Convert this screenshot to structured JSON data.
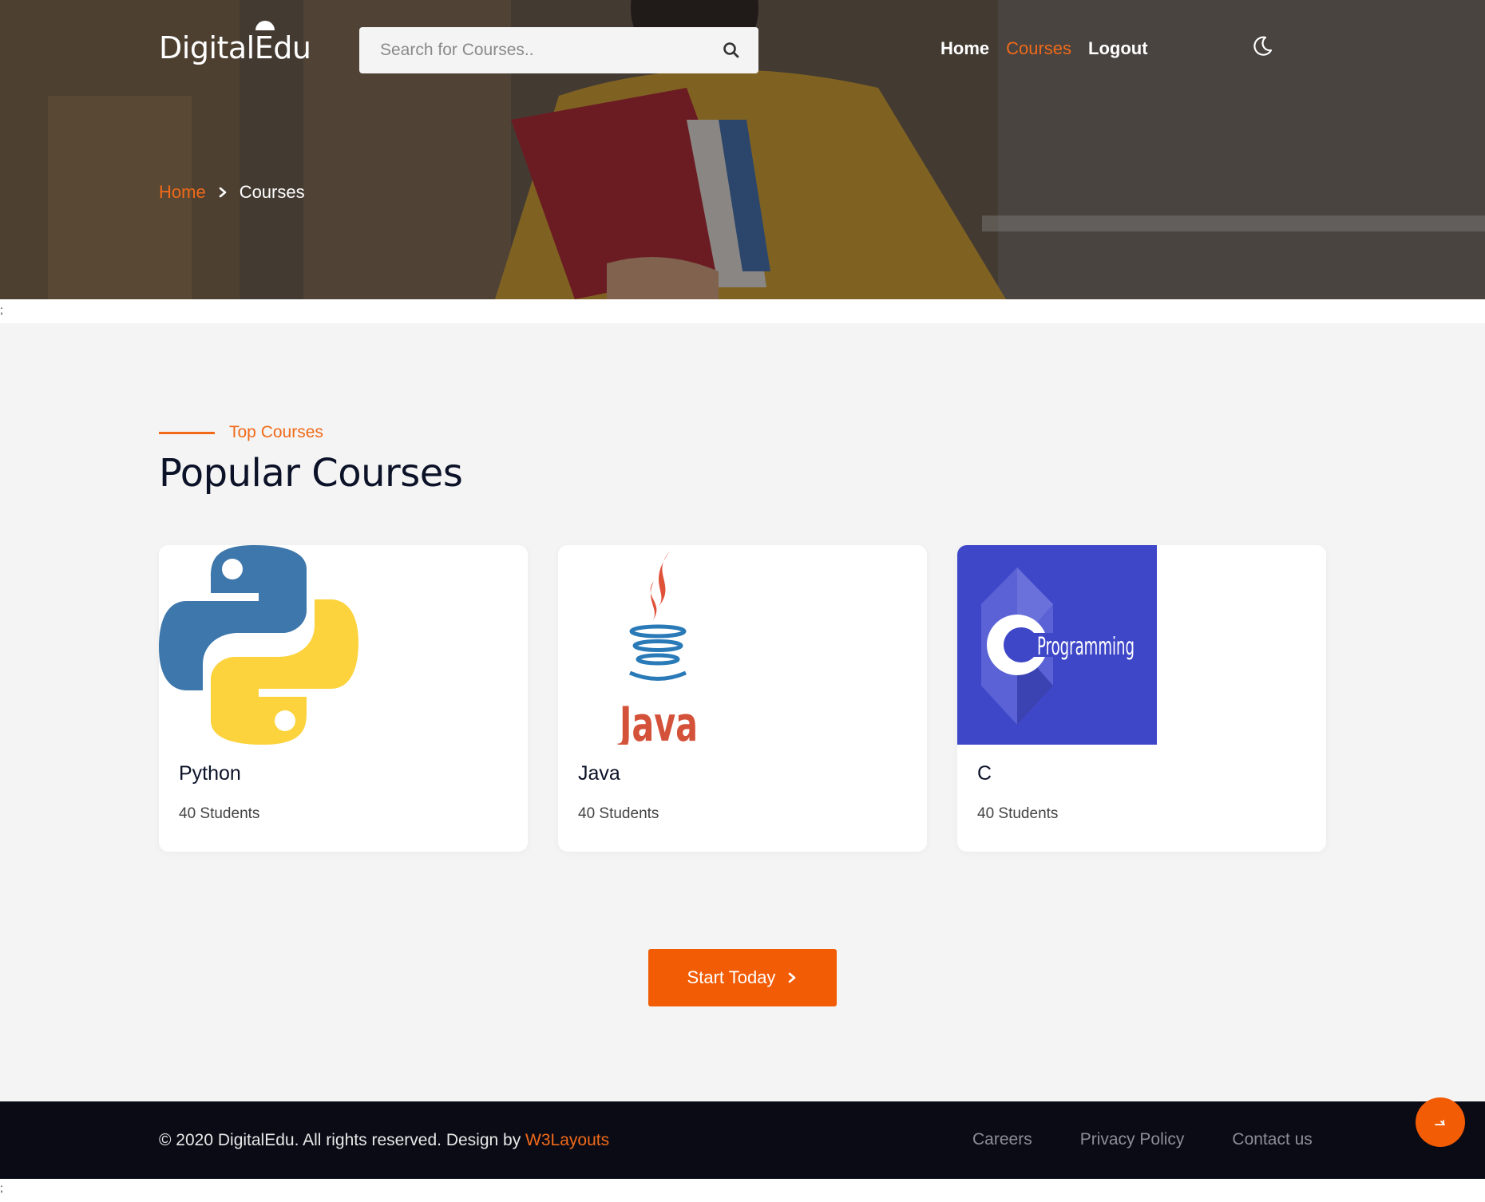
{
  "header": {
    "logo": "DigitalEdu",
    "search": {
      "placeholder": "Search for Courses..",
      "value": ""
    },
    "nav": [
      {
        "label": "Home",
        "active": false
      },
      {
        "label": "Courses",
        "active": true
      },
      {
        "label": "Logout",
        "active": false
      }
    ],
    "theme_toggle_icon": "moon-icon"
  },
  "breadcrumb": {
    "home": "Home",
    "current": "Courses"
  },
  "stray_text": ";",
  "section": {
    "eyebrow": "Top Courses",
    "title": "Popular Courses",
    "courses": [
      {
        "name": "Python",
        "students": "40 Students",
        "image": "python-logo"
      },
      {
        "name": "Java",
        "students": "40 Students",
        "image": "java-logo"
      },
      {
        "name": "C",
        "students": "40 Students",
        "image": "c-programming-logo",
        "image_text": "Programming"
      }
    ],
    "cta_label": "Start Today"
  },
  "footer": {
    "copyright": "© 2020 DigitalEdu. All rights reserved. Design by ",
    "designer": "W3Layouts",
    "links": [
      "Careers",
      "Privacy Policy",
      "Contact us"
    ]
  },
  "colors": {
    "accent": "#f06a19",
    "button": "#f25c05",
    "heading": "#0c1228",
    "footer_bg": "#0b0b16",
    "section_bg": "#f4f4f4"
  }
}
